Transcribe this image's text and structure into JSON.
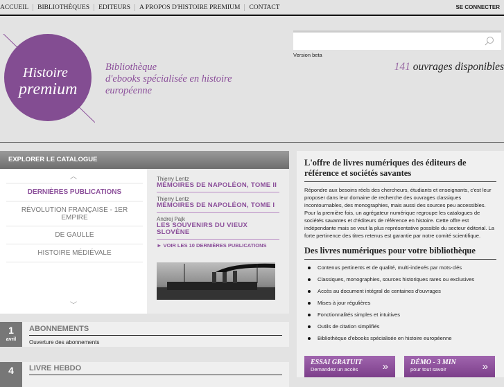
{
  "nav": {
    "items": [
      "ACCUEIL",
      "BIBLIOTHÈQUES",
      "EDITEURS",
      "A PROPOS D'HISTOIRE PREMIUM",
      "CONTACT"
    ],
    "login": "SE CONNECTER"
  },
  "brand": {
    "logo_text_1": "Histoire",
    "logo_text_2": "premium",
    "color": "#8b4f9a",
    "tagline": [
      "Bibliothèque",
      "d'ebooks spécialisée en histoire",
      "européenne"
    ]
  },
  "search": {
    "placeholder": "",
    "value": "",
    "icon": "search-icon",
    "beta": "Version beta"
  },
  "count": {
    "number": "141",
    "label": " ouvrages disponibles"
  },
  "catalog": {
    "title": "EXPLORER LE CATALOGUE",
    "categories": [
      "DERNIÈRES PUBLICATIONS",
      "RÉVOLUTION FRANÇAISE - 1ER EMPIRE",
      "DE GAULLE",
      "HISTOIRE MÉDIÉVALE"
    ],
    "active": 0,
    "publications": [
      {
        "author": "Thierry Lentz",
        "title": "MÉMOIRES DE NAPOLÉON, TOME II"
      },
      {
        "author": "Thierry Lentz",
        "title": "MÉMOIRES DE NAPOLÉON, TOME I"
      },
      {
        "author": "Andrej Pajk",
        "title": "LES SOUVENIRS DU VIEUX SLOVÈNE"
      }
    ],
    "see_all": "► VOIR LES 10 DERNIÈRES PUBLICATIONS"
  },
  "news": [
    {
      "day": "1",
      "month": "avril",
      "title": "ABONNEMENTS",
      "body": "Ouverture des abonnements"
    },
    {
      "day": "4",
      "month": "",
      "title": "LIVRE HEBDO",
      "body": ""
    }
  ],
  "offer": {
    "title": "L'offre de livres numériques des éditeurs de référence et sociétés savantes",
    "body": "Répondre aux besoins réels des chercheurs, étudiants et enseignants, c'est leur proposer dans leur domaine de recherche des ouvrages classiques incontournables, des monographies, mais aussi des sources peu accessibles. Pour la première fois, un agrégateur numérique regroupe les catalogues de sociétés savantes et d'éditeurs de référence en histoire. Cette offre est indépendante mais se veut la plus représentative possible du secteur éditorial. La forte pertinence des titres retenus est garantie par notre comité scientifique.",
    "subtitle": "Des livres numériques pour votre bibliothèque",
    "features": [
      "Contenus pertinents et de qualité, multi-indexés par mots-clés",
      "Classiques, monographies, sources historiques rares ou exclusives",
      "Accès au document intégral de centaines d'ouvrages",
      "Mises à jour régulières",
      "Fonctionnalités simples et intuitives",
      "Outils de citation simplifiés",
      "Bibliothèque d'ebooks spécialisée en histoire européenne"
    ],
    "cta": [
      {
        "title": "ESSAI GRATUIT",
        "sub": "Demandez un accès",
        "arrow": "»"
      },
      {
        "title": "DÉMO - 3 MIN",
        "sub": "pour tout savoir",
        "arrow": "»"
      }
    ]
  }
}
